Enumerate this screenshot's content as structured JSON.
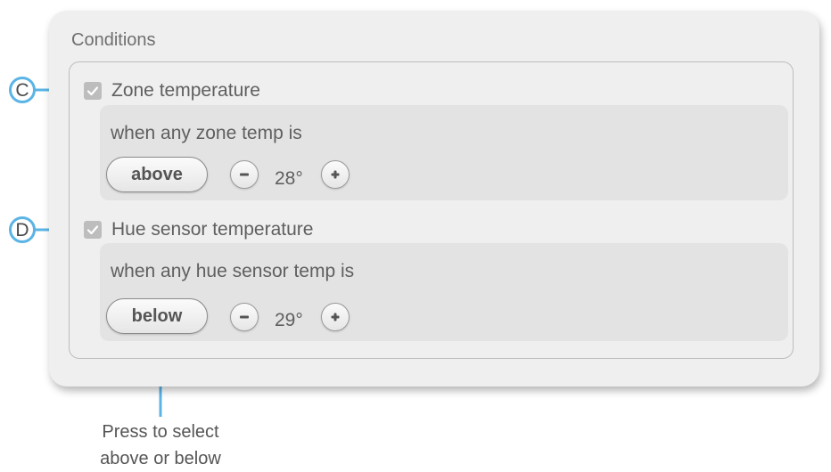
{
  "panel": {
    "title": "Conditions"
  },
  "conditions": [
    {
      "label": "Zone temperature",
      "checked": true,
      "description": "when any zone temp is",
      "mode": "above",
      "value": "28°",
      "marker": "C"
    },
    {
      "label": "Hue sensor temperature",
      "checked": true,
      "description": "when any hue sensor temp is",
      "mode": "below",
      "value": "29°",
      "marker": "D"
    }
  ],
  "callout": {
    "line1": "Press to select",
    "line2": "above or below"
  },
  "icons": {
    "checkbox": "checkmark-icon",
    "decrement": "minus-icon",
    "increment": "plus-icon"
  },
  "colors": {
    "accent": "#5ab4e5",
    "panel": "#efefef",
    "condition_box": "#e3e3e3",
    "checkbox": "#bdbdbd"
  }
}
